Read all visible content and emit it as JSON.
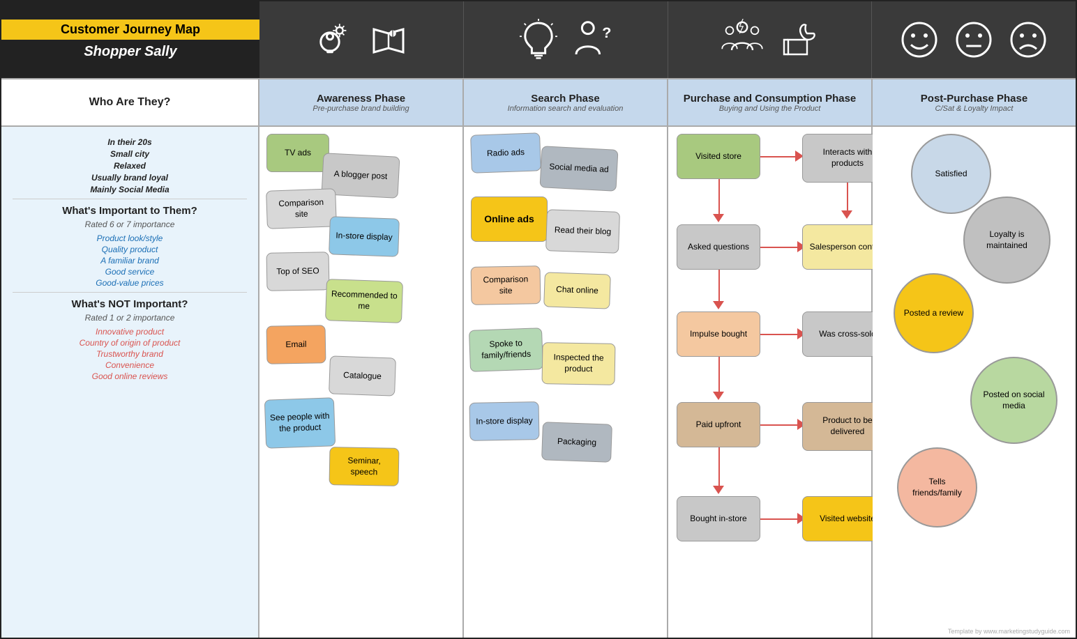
{
  "title": {
    "main": "Customer Journey Map",
    "sub": "Shopper Sally"
  },
  "phases": {
    "col0_header": "Who Are They?",
    "col1_header": "Awareness Phase",
    "col1_sub": "Pre-purchase brand building",
    "col2_header": "Search Phase",
    "col2_sub": "Information search and evaluation",
    "col3_header": "Purchase and Consumption Phase",
    "col3_sub": "Buying and Using the Product",
    "col4_header": "Post-Purchase Phase",
    "col4_sub": "C/Sat & Loyalty Impact"
  },
  "profile": {
    "items": [
      "In their 20s",
      "Small city",
      "Relaxed",
      "Usually brand loyal",
      "Mainly Social Media"
    ]
  },
  "important": {
    "header": "What's Important to Them?",
    "sub": "Rated 6 or 7 importance",
    "items": [
      "Product look/style",
      "Quality product",
      "A familiar brand",
      "Good service",
      "Good-value prices"
    ]
  },
  "not_important": {
    "header": "What's NOT Important?",
    "sub": "Rated 1 or 2 importance",
    "items": [
      "Innovative product",
      "Country of origin of product",
      "Trustworthy brand",
      "Convenience",
      "Good online reviews"
    ]
  },
  "awareness_cards": [
    {
      "label": "TV ads",
      "color": "c-green"
    },
    {
      "label": "A blogger post",
      "color": "c-gray-light"
    },
    {
      "label": "Comparison site",
      "color": "c-light-gray"
    },
    {
      "label": "In-store display",
      "color": "c-blue-light"
    },
    {
      "label": "Top of SEO",
      "color": "c-light-gray"
    },
    {
      "label": "Recommended to me",
      "color": "c-yellow-green"
    },
    {
      "label": "Email",
      "color": "c-salmon"
    },
    {
      "label": "Catalogue",
      "color": "c-light-gray"
    },
    {
      "label": "See people with the product",
      "color": "c-blue-light"
    },
    {
      "label": "Seminar, speech",
      "color": "c-yellow"
    }
  ],
  "search_cards": [
    {
      "label": "Radio ads",
      "color": "c-light-blue"
    },
    {
      "label": "Social media ad",
      "color": "c-gray2"
    },
    {
      "label": "Online ads",
      "color": "c-yellow"
    },
    {
      "label": "Read their blog",
      "color": "c-light-gray"
    },
    {
      "label": "Comparison site",
      "color": "c-peach"
    },
    {
      "label": "Chat online",
      "color": "c-light-yellow"
    },
    {
      "label": "Spoke to family/friends",
      "color": "c-light-green"
    },
    {
      "label": "Inspected the product",
      "color": "c-light-yellow"
    },
    {
      "label": "In-store display",
      "color": "c-light-blue"
    },
    {
      "label": "Packaging",
      "color": "c-gray2"
    }
  ],
  "purchase_left": [
    {
      "label": "Visited store",
      "color": "c-green"
    },
    {
      "label": "Asked questions",
      "color": "c-gray-light"
    },
    {
      "label": "Impulse bought",
      "color": "c-peach"
    },
    {
      "label": "Paid upfront",
      "color": "c-tan"
    },
    {
      "label": "Bought in-store",
      "color": "c-gray-light"
    }
  ],
  "purchase_right": [
    {
      "label": "Interacts with products",
      "color": "c-gray-light"
    },
    {
      "label": "Salesperson contact",
      "color": "c-light-yellow"
    },
    {
      "label": "Was cross-sold",
      "color": "c-gray-light"
    },
    {
      "label": "Product to be delivered",
      "color": "c-tan"
    },
    {
      "label": "Visited website",
      "color": "c-yellow"
    }
  ],
  "post_purchase": [
    {
      "label": "Satisfied",
      "color": "#c8d8e8"
    },
    {
      "label": "Loyalty is maintained",
      "color": "#c0c0c0"
    },
    {
      "label": "Posted a review",
      "color": "#f5c518"
    },
    {
      "label": "Posted on social media",
      "color": "#b8d8a0"
    },
    {
      "label": "Tells friends/family",
      "color": "#f4b8a0"
    }
  ],
  "watermark": "Template by www.marketingstudyguide.com"
}
